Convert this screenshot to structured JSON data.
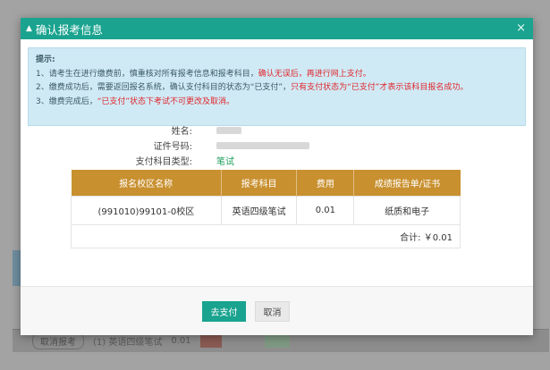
{
  "dialog": {
    "title": "确认报考信息",
    "close_symbol": "×"
  },
  "notice": {
    "title": "提示:",
    "line1_part1": "1、请考生在进行缴费前，慎重核对所有报考信息和报考科目，",
    "line1_part2": "确认无误后，再进行网上支付。",
    "line2_part1": "2、缴费成功后，需要返回报名系统，确认支付科目的状态为“已支付”，",
    "line2_part2": "只有支付状态为“已支付”才表示该科目报名成功。",
    "line3_part1": "3、缴费完成后，",
    "line3_part2": "“已支付”状态下考试不可更改及取消。"
  },
  "info": {
    "name_label": "姓名:",
    "id_label": "证件号码:",
    "pay_type_label": "支付科目类型:",
    "pay_type_value": "笔试"
  },
  "table": {
    "headers": [
      "报名校区名称",
      "报考科目",
      "费用",
      "成绩报告单/证书"
    ],
    "rows": [
      [
        "(991010)99101-0校区",
        "英语四级笔试",
        "0.01",
        "纸质和电子"
      ]
    ],
    "total": "合计: ￥0.01"
  },
  "footer": {
    "pay_label": "去支付",
    "cancel_label": "取消"
  },
  "background": {
    "cancel_chip": "取消报考",
    "row_text": "(1) 英语四级笔试",
    "fee": "0.01"
  },
  "colors": {
    "accent": "#1aa38f",
    "table_header": "#c8902f",
    "warning_red": "#e1262d",
    "notice_bg": "#cfeaf5"
  }
}
